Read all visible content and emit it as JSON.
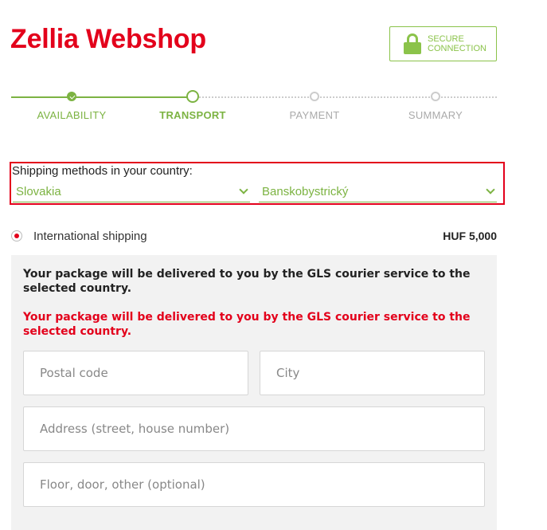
{
  "header": {
    "title": "Zellia Webshop",
    "secure_line1": "SECURE",
    "secure_line2": "CONNECTION"
  },
  "steps": [
    {
      "label": "AVAILABILITY",
      "state": "done"
    },
    {
      "label": "TRANSPORT",
      "state": "current"
    },
    {
      "label": "PAYMENT",
      "state": "todo"
    },
    {
      "label": "SUMMARY",
      "state": "todo"
    }
  ],
  "country_section": {
    "label": "Shipping methods in your country:",
    "country_value": "Slovakia",
    "region_value": "Banskobystrický"
  },
  "shipping": {
    "name": "International shipping",
    "price": "HUF 5,000",
    "selected": true
  },
  "panel": {
    "info_text": "Your package will be delivered to you by the GLS courier service to the selected country.",
    "warning_text": "Your package will be delivered to you by the GLS courier service to the selected country."
  },
  "form": {
    "postal_code_placeholder": "Postal code",
    "city_placeholder": "City",
    "address_placeholder": "Address (street, house number)",
    "floor_placeholder": "Floor, door, other (optional)"
  },
  "colors": {
    "brand_red": "#e3001b",
    "accent_green": "#7cb342"
  }
}
